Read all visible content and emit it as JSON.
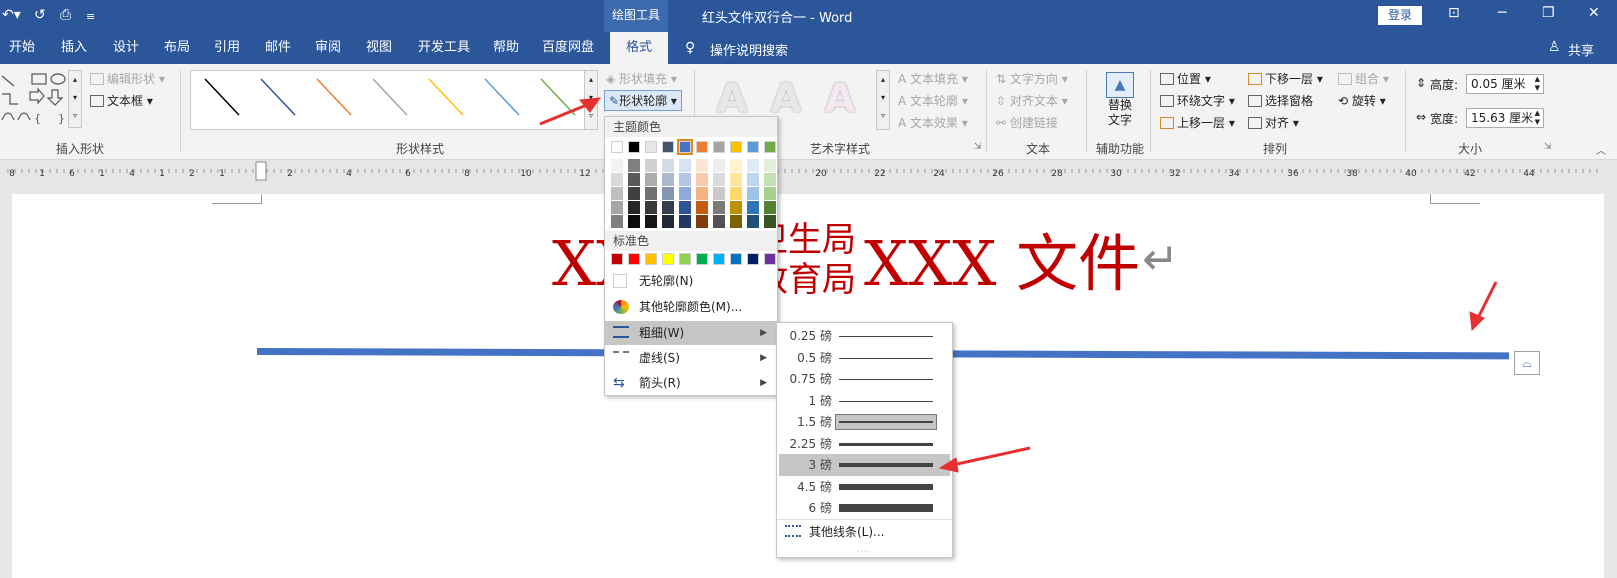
{
  "titlebar": {
    "context_label": "绘图工具",
    "doc_title": "红头文件双行合一",
    "app_sep": "-",
    "app_name": "Word",
    "login_label": "登录",
    "customize_glyph": "≡"
  },
  "tabs": [
    "开始",
    "插入",
    "设计",
    "布局",
    "引用",
    "邮件",
    "审阅",
    "视图",
    "开发工具",
    "帮助",
    "百度网盘",
    "格式"
  ],
  "tell_me": "操作说明搜索",
  "share": "共享",
  "ribbon": {
    "insert_shapes": {
      "edit_shape": "编辑形状",
      "text_box": "文本框",
      "group_label": "插入形状"
    },
    "shape_styles": {
      "fill": "形状填充",
      "outline": "形状轮廓",
      "group_label": "形状样式",
      "line_colors": [
        "#000000",
        "#2f5597",
        "#ed7d31",
        "#a5a5a5",
        "#ffc000",
        "#5b9bd5",
        "#70ad47"
      ]
    },
    "wordart": {
      "text_fill": "文本填充",
      "text_outline": "文本轮廓",
      "text_effect": "文本效果",
      "group_label": "艺术字样式",
      "sample": "A"
    },
    "text_group": {
      "direction": "文字方向",
      "align": "对齐文本",
      "link": "创建链接",
      "group_label": "文本"
    },
    "accessibility": {
      "alt_text_line1": "替换",
      "alt_text_line2": "文字",
      "group_label": "辅助功能"
    },
    "arrange": {
      "position": "位置",
      "wrap": "环绕文字",
      "forward": "上移一层",
      "backward": "下移一层",
      "selection_pane": "选择窗格",
      "align": "对齐",
      "group": "组合",
      "rotate": "旋转",
      "group_label": "排列"
    },
    "size": {
      "height_label": "高度:",
      "height_value": "0.05 厘米",
      "width_label": "宽度:",
      "width_value": "15.63 厘米",
      "group_label": "大小"
    }
  },
  "ruler": {
    "left_numbers": [
      "8",
      "1",
      "6",
      "1",
      "4",
      "1",
      "2",
      "1"
    ],
    "right_numbers": [
      "2",
      "4",
      "6",
      "8",
      "10",
      "12",
      "14",
      "16",
      "18",
      "20",
      "22",
      "24",
      "26",
      "28",
      "30",
      "32",
      "34",
      "36",
      "38",
      "40",
      "42",
      "44"
    ]
  },
  "document": {
    "header_left": "XX",
    "line_top": "卫生局",
    "line_bottom": "教育局",
    "header_right": "XXX 文件",
    "para_mark": "↵",
    "separator_color": "#4472c4",
    "header_color": "#c00000"
  },
  "outline_menu": {
    "theme_colors_label": "主题颜色",
    "theme_colors": [
      "#ffffff",
      "#000000",
      "#e7e6e6",
      "#44546a",
      "#4472c4",
      "#ed7d31",
      "#a5a5a5",
      "#ffc000",
      "#5b9bd5",
      "#70ad47"
    ],
    "theme_shade_columns": [
      [
        "#f2f2f2",
        "#d9d9d9",
        "#bfbfbf",
        "#a6a6a6",
        "#808080"
      ],
      [
        "#808080",
        "#595959",
        "#404040",
        "#262626",
        "#0d0d0d"
      ],
      [
        "#d0cece",
        "#aeabab",
        "#757070",
        "#3a3838",
        "#171616"
      ],
      [
        "#d6dce4",
        "#adb9ca",
        "#8496b0",
        "#333f50",
        "#222a35"
      ],
      [
        "#d9e2f3",
        "#b4c6e7",
        "#8eaadb",
        "#2f5496",
        "#1f3864"
      ],
      [
        "#fbe5d5",
        "#f7cbac",
        "#f4b183",
        "#c55a11",
        "#833c0b"
      ],
      [
        "#ededed",
        "#dbdbdb",
        "#c9c9c9",
        "#7b7b7b",
        "#525252"
      ],
      [
        "#fff2cc",
        "#fee599",
        "#ffd965",
        "#bf9000",
        "#7f6000"
      ],
      [
        "#deebf6",
        "#bdd7ee",
        "#9dc3e6",
        "#2e75b5",
        "#1f4e79"
      ],
      [
        "#e2efd9",
        "#c5e0b3",
        "#a8d08d",
        "#538135",
        "#375623"
      ]
    ],
    "standard_colors_label": "标准色",
    "standard_colors": [
      "#c00000",
      "#ff0000",
      "#ffc000",
      "#ffff00",
      "#92d050",
      "#00b050",
      "#00b0f0",
      "#0070c0",
      "#002060",
      "#7030a0"
    ],
    "no_outline": "无轮廓(N)",
    "more_colors": "其他轮廓颜色(M)...",
    "weight": "粗细(W)",
    "dashes": "虚线(S)",
    "arrows": "箭头(R)"
  },
  "weight_menu": {
    "items": [
      {
        "label": "0.25 磅",
        "pt": 0.25
      },
      {
        "label": "0.5 磅",
        "pt": 0.5
      },
      {
        "label": "0.75 磅",
        "pt": 0.75
      },
      {
        "label": "1 磅",
        "pt": 1
      },
      {
        "label": "1.5 磅",
        "pt": 1.5
      },
      {
        "label": "2.25 磅",
        "pt": 2.25
      },
      {
        "label": "3 磅",
        "pt": 3
      },
      {
        "label": "4.5 磅",
        "pt": 4.5
      },
      {
        "label": "6 磅",
        "pt": 6
      }
    ],
    "selected": "1.5 磅",
    "hovered": "3 磅",
    "more_lines": "其他线条(L)..."
  }
}
